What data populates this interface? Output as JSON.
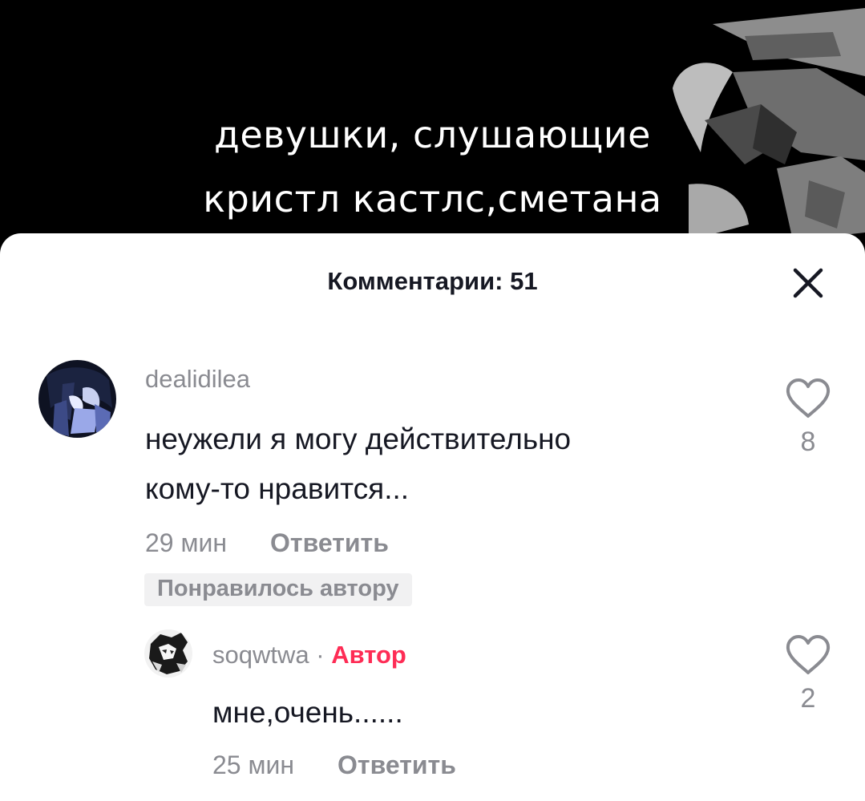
{
  "video": {
    "caption_lines": [
      "девушки, слушающие",
      "кристл кастлс,сметана"
    ]
  },
  "comments_panel": {
    "title": "Комментарии: 51",
    "close_icon": "close-icon"
  },
  "comments": [
    {
      "username": "dealidilea",
      "text_lines": [
        "неужели я могу действительно",
        "кому-то нравится..."
      ],
      "time": "29 мин",
      "reply_label": "Ответить",
      "badge": "Понравилось автору",
      "like_count": "8"
    }
  ],
  "reply": {
    "username": "soqwtwa",
    "separator": "·",
    "author_label": "Автор",
    "text": "мне,очень......",
    "time": "25 мин",
    "reply_label": "Ответить",
    "like_count": "2"
  },
  "colors": {
    "author_accent": "#fe2c55",
    "secondary_text": "#8a8b91",
    "primary_text": "#161823",
    "badge_bg": "#f1f1f2"
  }
}
